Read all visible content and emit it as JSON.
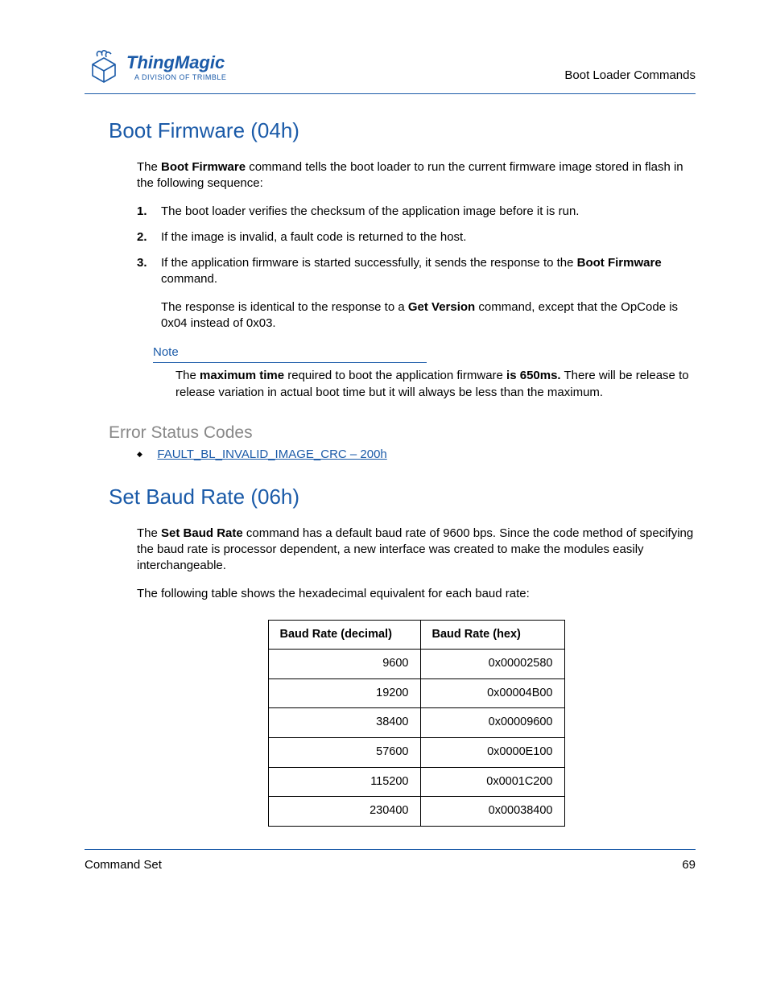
{
  "header": {
    "brand_name": "ThingMagic",
    "tagline": "A DIVISION OF TRIMBLE",
    "right_text": "Boot Loader Commands"
  },
  "section1": {
    "title": "Boot Firmware (04h)",
    "intro_pre": "The ",
    "intro_bold": "Boot Firmware",
    "intro_post": " command tells the boot loader to run the current firmware image stored in flash in the following sequence:",
    "items": [
      {
        "num": "1.",
        "text": "The boot loader verifies the checksum of the application image before it is run."
      },
      {
        "num": "2.",
        "text": "If the image is invalid, a fault code is returned to the host."
      },
      {
        "num": "3.",
        "text_pre": "If the application firmware is started successfully, it sends the response to the ",
        "text_bold": "Boot Firmware",
        "text_post": " command."
      }
    ],
    "resp_pre": "The response is identical to the response to a ",
    "resp_bold": "Get Version",
    "resp_post": " command, except that the OpCode is 0x04 instead of 0x03.",
    "note_label": "Note",
    "note_pre": "The ",
    "note_bold1": "maximum time",
    "note_mid": " required to boot the application firmware ",
    "note_bold2": "is 650ms.",
    "note_post": " There will be release to release variation in actual boot time but it will always be less than the maximum.",
    "error_title": "Error Status Codes",
    "error_link": "FAULT_BL_INVALID_IMAGE_CRC – 200h"
  },
  "section2": {
    "title": "Set Baud Rate (06h)",
    "intro_pre": "The ",
    "intro_bold": "Set Baud Rate",
    "intro_post": " command has a default baud rate of 9600 bps. Since the code method of specifying the baud rate is processor dependent, a new interface was created to make the modules easily interchangeable.",
    "table_intro": "The following table shows the hexadecimal equivalent for each baud rate:",
    "table": {
      "h1": "Baud Rate (decimal)",
      "h2": "Baud Rate (hex)",
      "rows": [
        {
          "dec": "9600",
          "hex": "0x00002580"
        },
        {
          "dec": "19200",
          "hex": "0x00004B00"
        },
        {
          "dec": "38400",
          "hex": "0x00009600"
        },
        {
          "dec": "57600",
          "hex": "0x0000E100"
        },
        {
          "dec": "115200",
          "hex": "0x0001C200"
        },
        {
          "dec": "230400",
          "hex": "0x00038400"
        }
      ]
    }
  },
  "footer": {
    "left": "Command Set",
    "right": "69"
  }
}
